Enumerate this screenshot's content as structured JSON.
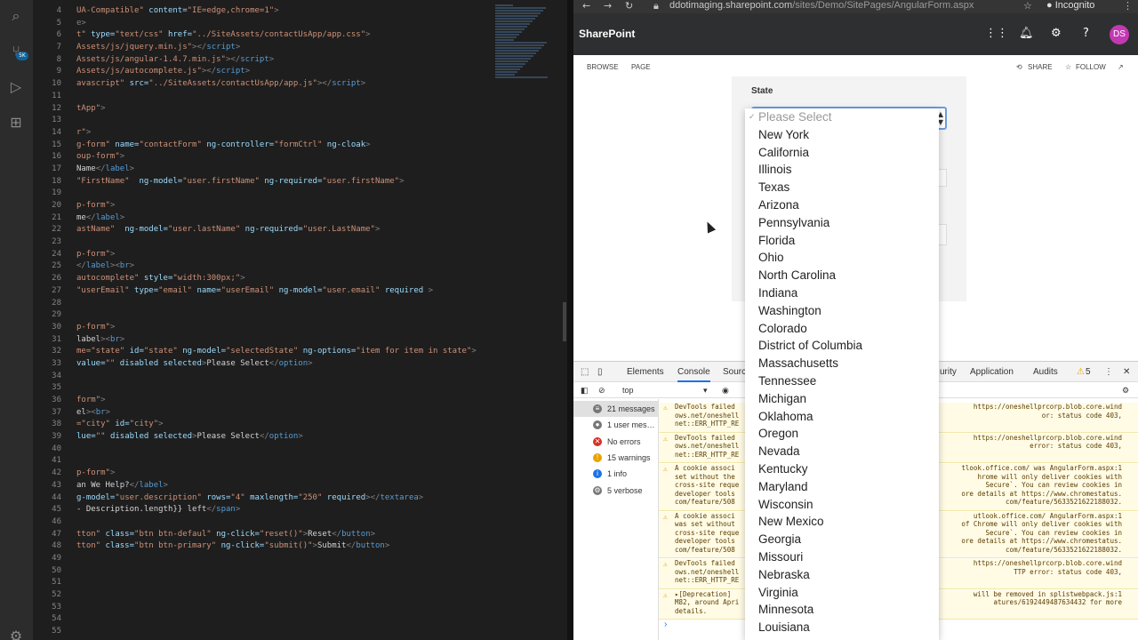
{
  "editor": {
    "lines": [
      {
        "num": "4",
        "segs": [
          {
            "c": "st",
            "t": "UA-Compatible\""
          },
          {
            "c": "at",
            "t": " content="
          },
          {
            "c": "st",
            "t": "\"IE=edge,chrome=1\""
          },
          {
            "c": "tg",
            "t": ">"
          }
        ]
      },
      {
        "num": "5",
        "segs": [
          {
            "c": "tg",
            "t": "e>"
          }
        ]
      },
      {
        "num": "6",
        "segs": [
          {
            "c": "st",
            "t": "t\""
          },
          {
            "c": "at",
            "t": " type="
          },
          {
            "c": "st",
            "t": "\"text/css\""
          },
          {
            "c": "at",
            "t": " href="
          },
          {
            "c": "st",
            "t": "\"../SiteAssets/contactUsApp/app.css\""
          },
          {
            "c": "tg",
            "t": ">"
          }
        ]
      },
      {
        "num": "7",
        "segs": [
          {
            "c": "st",
            "t": "Assets/js/jquery.min.js\""
          },
          {
            "c": "tg",
            "t": "></"
          },
          {
            "c": "kw",
            "t": "script"
          },
          {
            "c": "tg",
            "t": ">"
          }
        ]
      },
      {
        "num": "8",
        "segs": [
          {
            "c": "st",
            "t": "Assets/js/angular-1.4.7.min.js\""
          },
          {
            "c": "tg",
            "t": "></"
          },
          {
            "c": "kw",
            "t": "script"
          },
          {
            "c": "tg",
            "t": ">"
          }
        ]
      },
      {
        "num": "9",
        "segs": [
          {
            "c": "st",
            "t": "Assets/js/autocomplete.js\""
          },
          {
            "c": "tg",
            "t": "></"
          },
          {
            "c": "kw",
            "t": "script"
          },
          {
            "c": "tg",
            "t": ">"
          }
        ]
      },
      {
        "num": "10",
        "segs": [
          {
            "c": "st",
            "t": "avascript\""
          },
          {
            "c": "at",
            "t": " src="
          },
          {
            "c": "st",
            "t": "\"../SiteAssets/contactUsApp/app.js\""
          },
          {
            "c": "tg",
            "t": "></"
          },
          {
            "c": "kw",
            "t": "script"
          },
          {
            "c": "tg",
            "t": ">"
          }
        ]
      },
      {
        "num": "11",
        "segs": []
      },
      {
        "num": "12",
        "segs": [
          {
            "c": "st",
            "t": "tApp\""
          },
          {
            "c": "tg",
            "t": ">"
          }
        ]
      },
      {
        "num": "13",
        "segs": []
      },
      {
        "num": "14",
        "segs": [
          {
            "c": "st",
            "t": "r\""
          },
          {
            "c": "tg",
            "t": ">"
          }
        ]
      },
      {
        "num": "15",
        "segs": [
          {
            "c": "st",
            "t": "g-form\""
          },
          {
            "c": "at",
            "t": " name="
          },
          {
            "c": "st",
            "t": "\"contactForm\""
          },
          {
            "c": "at",
            "t": " ng-controller="
          },
          {
            "c": "st",
            "t": "\"formCtrl\""
          },
          {
            "c": "at",
            "t": " ng-cloak"
          },
          {
            "c": "tg",
            "t": ">"
          }
        ]
      },
      {
        "num": "16",
        "segs": [
          {
            "c": "st",
            "t": "oup-form\""
          },
          {
            "c": "tg",
            "t": ">"
          }
        ]
      },
      {
        "num": "17",
        "segs": [
          {
            "c": "tx",
            "t": "Name"
          },
          {
            "c": "tg",
            "t": "</"
          },
          {
            "c": "kw",
            "t": "label"
          },
          {
            "c": "tg",
            "t": ">"
          }
        ]
      },
      {
        "num": "18",
        "segs": [
          {
            "c": "st",
            "t": "\"FirstName\""
          },
          {
            "c": "at",
            "t": "  ng-model="
          },
          {
            "c": "st",
            "t": "\"user.firstName\""
          },
          {
            "c": "at",
            "t": " ng-required="
          },
          {
            "c": "st",
            "t": "\"user.firstName\""
          },
          {
            "c": "tg",
            "t": ">"
          }
        ]
      },
      {
        "num": "19",
        "segs": []
      },
      {
        "num": "20",
        "segs": [
          {
            "c": "st",
            "t": "p-form\""
          },
          {
            "c": "tg",
            "t": ">"
          }
        ]
      },
      {
        "num": "21",
        "segs": [
          {
            "c": "tx",
            "t": "me"
          },
          {
            "c": "tg",
            "t": "</"
          },
          {
            "c": "kw",
            "t": "label"
          },
          {
            "c": "tg",
            "t": ">"
          }
        ]
      },
      {
        "num": "22",
        "segs": [
          {
            "c": "st",
            "t": "astName\""
          },
          {
            "c": "at",
            "t": "  ng-model="
          },
          {
            "c": "st",
            "t": "\"user.lastName\""
          },
          {
            "c": "at",
            "t": " ng-required="
          },
          {
            "c": "st",
            "t": "\"user.LastName\""
          },
          {
            "c": "tg",
            "t": ">"
          }
        ]
      },
      {
        "num": "23",
        "segs": []
      },
      {
        "num": "24",
        "segs": [
          {
            "c": "st",
            "t": "p-form\""
          },
          {
            "c": "tg",
            "t": ">"
          }
        ]
      },
      {
        "num": "25",
        "segs": [
          {
            "c": "tg",
            "t": "</"
          },
          {
            "c": "kw",
            "t": "label"
          },
          {
            "c": "tg",
            "t": "><"
          },
          {
            "c": "kw",
            "t": "br"
          },
          {
            "c": "tg",
            "t": ">"
          }
        ]
      },
      {
        "num": "26",
        "segs": [
          {
            "c": "st",
            "t": "autocomplete\""
          },
          {
            "c": "at",
            "t": " style="
          },
          {
            "c": "st",
            "t": "\"width:300px;\""
          },
          {
            "c": "tg",
            "t": ">"
          }
        ]
      },
      {
        "num": "27",
        "segs": [
          {
            "c": "st",
            "t": "\"userEmail\""
          },
          {
            "c": "at",
            "t": " type="
          },
          {
            "c": "st",
            "t": "\"email\""
          },
          {
            "c": "at",
            "t": " name="
          },
          {
            "c": "st",
            "t": "\"userEmail\""
          },
          {
            "c": "at",
            "t": " ng-model="
          },
          {
            "c": "st",
            "t": "\"user.email\""
          },
          {
            "c": "at",
            "t": " required "
          },
          {
            "c": "tg",
            "t": ">"
          }
        ]
      },
      {
        "num": "28",
        "segs": []
      },
      {
        "num": "29",
        "segs": []
      },
      {
        "num": "30",
        "segs": [
          {
            "c": "st",
            "t": "p-form\""
          },
          {
            "c": "tg",
            "t": ">"
          }
        ]
      },
      {
        "num": "31",
        "segs": [
          {
            "c": "tx",
            "t": "label"
          },
          {
            "c": "tg",
            "t": "><"
          },
          {
            "c": "kw",
            "t": "br"
          },
          {
            "c": "tg",
            "t": ">"
          }
        ]
      },
      {
        "num": "32",
        "segs": [
          {
            "c": "st",
            "t": "me=\"state\""
          },
          {
            "c": "at",
            "t": " id="
          },
          {
            "c": "st",
            "t": "\"state\""
          },
          {
            "c": "at",
            "t": " ng-model="
          },
          {
            "c": "st",
            "t": "\"selectedState\""
          },
          {
            "c": "at",
            "t": " ng-options="
          },
          {
            "c": "st",
            "t": "\"item for item in state\""
          },
          {
            "c": "tg",
            "t": ">"
          }
        ]
      },
      {
        "num": "33",
        "segs": [
          {
            "c": "at",
            "t": "value="
          },
          {
            "c": "st",
            "t": "\"\""
          },
          {
            "c": "at",
            "t": " disabled selected"
          },
          {
            "c": "tg",
            "t": ">"
          },
          {
            "c": "tx",
            "t": "Please Select"
          },
          {
            "c": "tg",
            "t": "</"
          },
          {
            "c": "kw",
            "t": "option"
          },
          {
            "c": "tg",
            "t": ">"
          }
        ]
      },
      {
        "num": "34",
        "segs": []
      },
      {
        "num": "35",
        "segs": []
      },
      {
        "num": "36",
        "segs": [
          {
            "c": "st",
            "t": "form\""
          },
          {
            "c": "tg",
            "t": ">"
          }
        ]
      },
      {
        "num": "37",
        "segs": [
          {
            "c": "tx",
            "t": "el"
          },
          {
            "c": "tg",
            "t": "><"
          },
          {
            "c": "kw",
            "t": "br"
          },
          {
            "c": "tg",
            "t": ">"
          }
        ]
      },
      {
        "num": "38",
        "segs": [
          {
            "c": "st",
            "t": "=\"city\""
          },
          {
            "c": "at",
            "t": " id="
          },
          {
            "c": "st",
            "t": "\"city\""
          },
          {
            "c": "tg",
            "t": ">"
          }
        ]
      },
      {
        "num": "39",
        "segs": [
          {
            "c": "at",
            "t": "lue="
          },
          {
            "c": "st",
            "t": "\"\""
          },
          {
            "c": "at",
            "t": " disabled selected"
          },
          {
            "c": "tg",
            "t": ">"
          },
          {
            "c": "tx",
            "t": "Please Select"
          },
          {
            "c": "tg",
            "t": "</"
          },
          {
            "c": "kw",
            "t": "option"
          },
          {
            "c": "tg",
            "t": ">"
          }
        ]
      },
      {
        "num": "40",
        "segs": []
      },
      {
        "num": "41",
        "segs": []
      },
      {
        "num": "42",
        "segs": [
          {
            "c": "st",
            "t": "p-form\""
          },
          {
            "c": "tg",
            "t": ">"
          }
        ]
      },
      {
        "num": "43",
        "segs": [
          {
            "c": "tx",
            "t": "an We Help?"
          },
          {
            "c": "tg",
            "t": "</"
          },
          {
            "c": "kw",
            "t": "label"
          },
          {
            "c": "tg",
            "t": ">"
          }
        ]
      },
      {
        "num": "44",
        "segs": [
          {
            "c": "at",
            "t": "g-model="
          },
          {
            "c": "st",
            "t": "\"user.description\""
          },
          {
            "c": "at",
            "t": " rows="
          },
          {
            "c": "st",
            "t": "\"4\""
          },
          {
            "c": "at",
            "t": " maxlength="
          },
          {
            "c": "st",
            "t": "\"250\""
          },
          {
            "c": "at",
            "t": " required"
          },
          {
            "c": "tg",
            "t": "></"
          },
          {
            "c": "kw",
            "t": "textarea"
          },
          {
            "c": "tg",
            "t": ">"
          }
        ]
      },
      {
        "num": "45",
        "segs": [
          {
            "c": "tx",
            "t": "- Description.length}} left"
          },
          {
            "c": "tg",
            "t": "</"
          },
          {
            "c": "kw",
            "t": "span"
          },
          {
            "c": "tg",
            "t": ">"
          }
        ]
      },
      {
        "num": "46",
        "segs": []
      },
      {
        "num": "47",
        "segs": [
          {
            "c": "st",
            "t": "tton\""
          },
          {
            "c": "at",
            "t": " class="
          },
          {
            "c": "st",
            "t": "\"btn btn-defaul\""
          },
          {
            "c": "at",
            "t": " ng-click="
          },
          {
            "c": "st",
            "t": "\"reset()\""
          },
          {
            "c": "tg",
            "t": ">"
          },
          {
            "c": "tx",
            "t": "Reset"
          },
          {
            "c": "tg",
            "t": "</"
          },
          {
            "c": "kw",
            "t": "button"
          },
          {
            "c": "tg",
            "t": ">"
          }
        ]
      },
      {
        "num": "48",
        "segs": [
          {
            "c": "st",
            "t": "tton\""
          },
          {
            "c": "at",
            "t": " class="
          },
          {
            "c": "st",
            "t": "\"btn btn-primary\""
          },
          {
            "c": "at",
            "t": " ng-click="
          },
          {
            "c": "st",
            "t": "\"submit()\""
          },
          {
            "c": "tg",
            "t": ">"
          },
          {
            "c": "tx",
            "t": "Submit"
          },
          {
            "c": "tg",
            "t": "</"
          },
          {
            "c": "kw",
            "t": "button"
          },
          {
            "c": "tg",
            "t": ">"
          }
        ]
      },
      {
        "num": "49",
        "segs": []
      },
      {
        "num": "50",
        "segs": []
      },
      {
        "num": "51",
        "segs": []
      },
      {
        "num": "52",
        "segs": []
      },
      {
        "num": "53",
        "segs": []
      },
      {
        "num": "54",
        "segs": []
      },
      {
        "num": "55",
        "segs": []
      }
    ]
  },
  "browser": {
    "url_host": "ddotimaging.sharepoint.com",
    "url_path": "/sites/Demo/SitePages/AngularForm.aspx",
    "incognito_label": "Incognito",
    "brand": "SharePoint",
    "avatar_initials": "DS",
    "ribbon": {
      "browse": "BROWSE",
      "page": "PAGE",
      "share": "SHARE",
      "follow": "FOLLOW"
    },
    "form": {
      "state_label": "State"
    }
  },
  "dropdown": {
    "placeholder": "Please Select",
    "options": [
      "New York",
      "California",
      "Illinois",
      "Texas",
      "Arizona",
      "Pennsylvania",
      "Florida",
      "Ohio",
      "North Carolina",
      "Indiana",
      "Washington",
      "Colorado",
      "District of Columbia",
      "Massachusetts",
      "Tennessee",
      "Michigan",
      "Oklahoma",
      "Oregon",
      "Nevada",
      "Kentucky",
      "Maryland",
      "Wisconsin",
      "New Mexico",
      "Georgia",
      "Missouri",
      "Nebraska",
      "Virginia",
      "Minnesota",
      "Louisiana"
    ]
  },
  "devtools": {
    "tabs": {
      "elements": "Elements",
      "console": "Console",
      "sources": "Sourc",
      "security": "urity",
      "application": "Application",
      "audits": "Audits",
      "warn_count": "5"
    },
    "context": "top",
    "sidebar": [
      {
        "label": "21 messages",
        "icon": "list-icon"
      },
      {
        "label": "1 user mes…",
        "icon": "user-icon"
      },
      {
        "label": "No errors",
        "icon": "error-icon"
      },
      {
        "label": "15 warnings",
        "icon": "warning-icon"
      },
      {
        "label": "1 info",
        "icon": "info-icon"
      },
      {
        "label": "5 verbose",
        "icon": "verbose-icon"
      }
    ],
    "messages": [
      {
        "lines": [
          "DevTools failed",
          "ows.net/oneshell",
          "net::ERR_HTTP_RE"
        ],
        "right": [
          "https://oneshellprcorp.blob.core.wind",
          "or: status code 403,"
        ]
      },
      {
        "lines": [
          "DevTools failed",
          "ows.net/oneshell",
          "net::ERR_HTTP_RE"
        ],
        "right": [
          "https://oneshellprcorp.blob.core.wind",
          "error: status code 403,"
        ]
      },
      {
        "lines": [
          "A cookie associ",
          "set without the",
          "cross-site reque",
          "developer tools",
          "com/feature/508"
        ],
        "right": [
          "tlook.office.com/ was AngularForm.aspx:1",
          "hrome will only deliver cookies with",
          "Secure`. You can review cookies in",
          "ore details at https://www.chromestatus.",
          "com/feature/5633521622188032."
        ]
      },
      {
        "lines": [
          "A cookie associ",
          "was set without",
          "cross-site reque",
          "developer tools",
          "com/feature/508"
        ],
        "right": [
          "utlook.office.com/   AngularForm.aspx:1",
          "of Chrome will only deliver cookies with",
          "Secure`. You can review cookies in",
          "ore details at https://www.chromestatus.",
          "com/feature/5633521622188032."
        ]
      },
      {
        "lines": [
          "DevTools failed",
          "ows.net/oneshell",
          "net::ERR_HTTP_RE"
        ],
        "right": [
          "https://oneshellprcorp.blob.core.wind",
          "TTP error: status code 403,"
        ]
      },
      {
        "lines": [
          "▸[Deprecation]",
          "M82, around Apri",
          "details."
        ],
        "right": [
          "will be removed in   splistwebpack.js:1",
          "atures/6192449487634432 for more"
        ]
      }
    ]
  }
}
